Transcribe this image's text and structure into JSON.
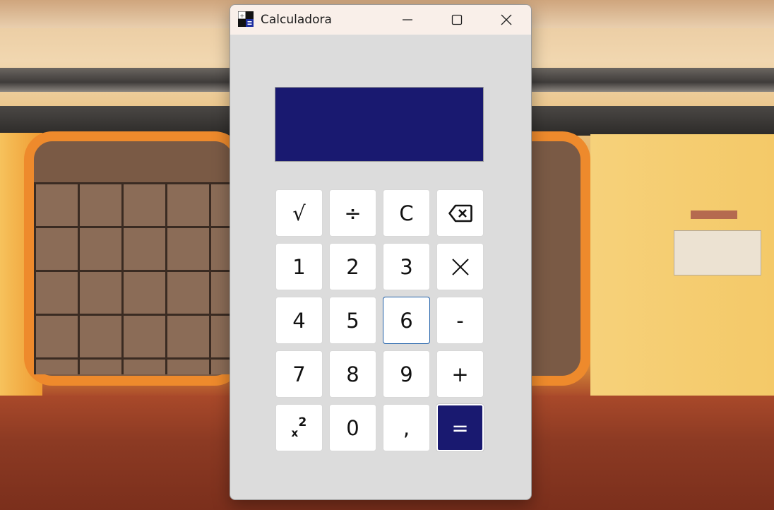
{
  "window": {
    "title": "Calculadora",
    "controls": [
      "minimize",
      "maximize",
      "close"
    ]
  },
  "display": {
    "value": ""
  },
  "keys": {
    "sqrt": "√",
    "divide": "÷",
    "clear": "C",
    "backspace_icon": "backspace-icon",
    "one": "1",
    "two": "2",
    "three": "3",
    "multiply_icon": "multiply-icon",
    "four": "4",
    "five": "5",
    "six": "6",
    "minus": "-",
    "seven": "7",
    "eight": "8",
    "nine": "9",
    "plus": "+",
    "square_base": "x",
    "square_exp": "2",
    "zero": "0",
    "comma": ",",
    "equals": "="
  },
  "colors": {
    "display_bg": "#191970",
    "equals_bg": "#191970",
    "titlebar_bg": "#f9efe9",
    "window_bg": "#dcdcdc",
    "focus_border": "#1f5fa8"
  }
}
